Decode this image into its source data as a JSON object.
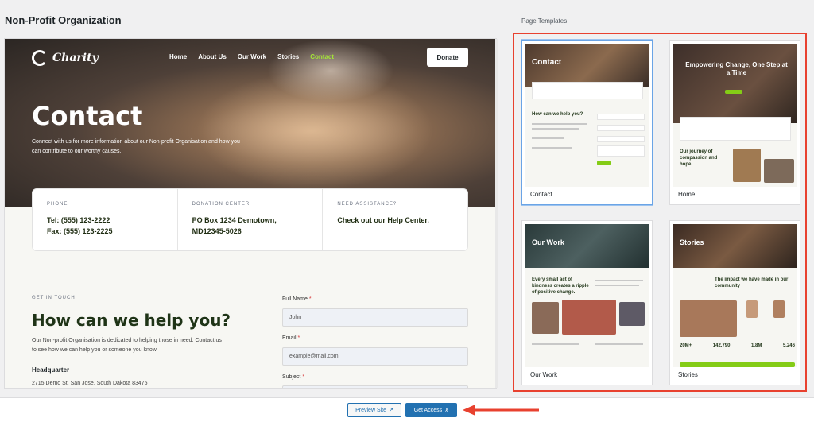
{
  "page": {
    "title": "Non-Profit Organization"
  },
  "preview": {
    "brand": "Charity",
    "nav": [
      "Home",
      "About Us",
      "Our Work",
      "Stories",
      "Contact"
    ],
    "donate_label": "Donate",
    "hero_title": "Contact",
    "hero_subtitle": "Connect with us for more information about our Non-profit Organisation and how you can contribute to our worthy causes.",
    "info": [
      {
        "label": "PHONE",
        "lines": [
          "Tel: (555) 123-2222",
          "Fax: (555) 123-2225"
        ]
      },
      {
        "label": "DONATION CENTER",
        "lines": [
          "PO Box 1234 Demotown,",
          "MD12345-5026"
        ]
      },
      {
        "label": "NEED ASSISTANCE?",
        "lines": [
          "Check out our Help Center.",
          ""
        ]
      }
    ],
    "get_in_touch": "GET IN TOUCH",
    "help_title": "How can we help you?",
    "help_text": "Our Non-profit Organisation is dedicated to helping those in need. Contact us to see how we can help you or someone you know.",
    "hq_title": "Headquarter",
    "hq_address": "2715 Demo St. San Jose, South Dakota 83475",
    "form": {
      "full_name_label": "Full Name",
      "full_name_value": "John",
      "email_label": "Email",
      "email_placeholder": "example@mail.com",
      "subject_label": "Subject",
      "required_mark": "*"
    }
  },
  "templates": {
    "heading": "Page Templates",
    "items": [
      {
        "name": "Contact",
        "thumb_title": "Contact",
        "thumb_sub": "How can we help you?",
        "selected": true
      },
      {
        "name": "Home",
        "thumb_title": "Empowering Change, One Step at a Time",
        "thumb_sub": "Our journey of compassion and hope",
        "selected": false
      },
      {
        "name": "Our Work",
        "thumb_title": "Our Work",
        "thumb_sub": "Every small act of kindness creates a ripple of positive change.",
        "selected": false
      },
      {
        "name": "Stories",
        "thumb_title": "Stories",
        "thumb_sub": "The impact we have made in our community",
        "stats": [
          "20M+",
          "142,790",
          "1.8M",
          "5,246"
        ],
        "selected": false
      }
    ]
  },
  "footer": {
    "preview_label": "Preview Site",
    "access_label": "Get Access",
    "preview_icon": "external-link-icon",
    "access_icon": "key-icon"
  },
  "colors": {
    "highlight_border": "#e8412f",
    "primary": "#2271b1",
    "accent_nav": "#a3e635",
    "heading_dark": "#1f3417"
  }
}
